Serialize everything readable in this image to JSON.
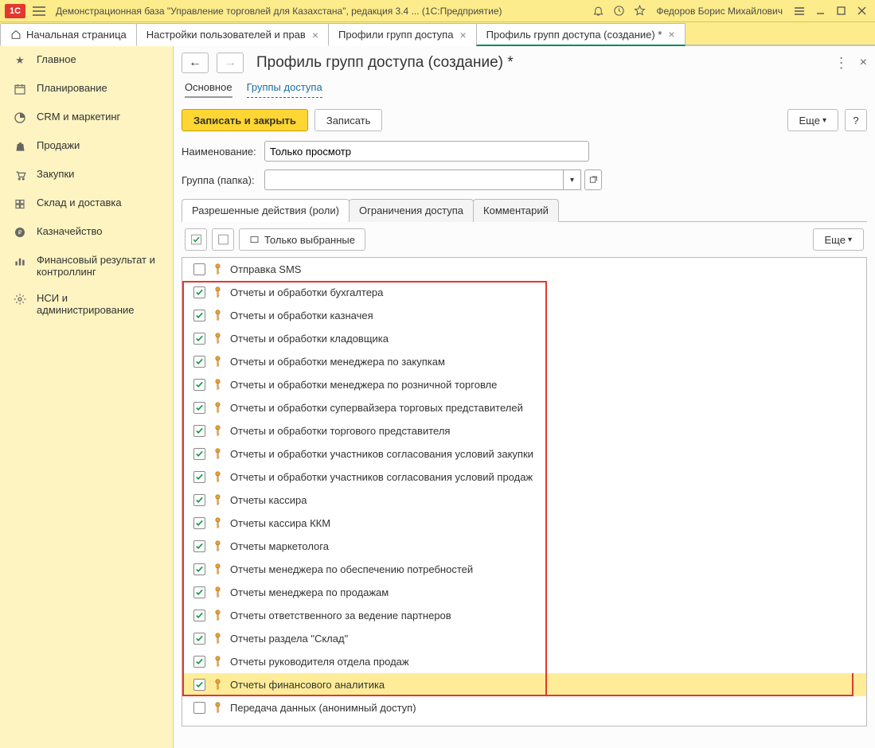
{
  "titlebar": {
    "app_title": "Демонстрационная база \"Управление торговлей для Казахстана\", редакция 3.4 ...  (1С:Предприятие)",
    "user": "Федоров Борис Михайлович"
  },
  "apptabs": {
    "home": "Начальная страница",
    "t1": "Настройки пользователей и прав",
    "t2": "Профили групп доступа",
    "t3": "Профиль групп доступа (создание) *"
  },
  "sidebar": {
    "items": [
      {
        "label": "Главное"
      },
      {
        "label": "Планирование"
      },
      {
        "label": "CRM и маркетинг"
      },
      {
        "label": "Продажи"
      },
      {
        "label": "Закупки"
      },
      {
        "label": "Склад и доставка"
      },
      {
        "label": "Казначейство"
      },
      {
        "label": "Финансовый результат и контроллинг"
      },
      {
        "label": "НСИ и администрирование"
      }
    ]
  },
  "form": {
    "title": "Профиль групп доступа (создание) *",
    "sub_main": "Основное",
    "sub_groups": "Группы доступа",
    "btn_write_close": "Записать и закрыть",
    "btn_write": "Записать",
    "btn_more": "Еще",
    "btn_q": "?",
    "lbl_name": "Наименование:",
    "val_name": "Только просмотр",
    "lbl_group": "Группа (папка):",
    "tab_roles": "Разрешенные действия (роли)",
    "tab_restrict": "Ограничения доступа",
    "tab_comment": "Комментарий",
    "btn_only_selected": "Только выбранные"
  },
  "roles": {
    "items": [
      {
        "checked": false,
        "label": "Отправка SMS"
      },
      {
        "checked": true,
        "label": "Отчеты и обработки бухгалтера"
      },
      {
        "checked": true,
        "label": "Отчеты и обработки казначея"
      },
      {
        "checked": true,
        "label": "Отчеты и обработки кладовщика"
      },
      {
        "checked": true,
        "label": "Отчеты и обработки менеджера по закупкам"
      },
      {
        "checked": true,
        "label": "Отчеты и обработки менеджера по розничной торговле"
      },
      {
        "checked": true,
        "label": "Отчеты и обработки супервайзера торговых представителей"
      },
      {
        "checked": true,
        "label": "Отчеты и обработки торгового представителя"
      },
      {
        "checked": true,
        "label": "Отчеты и обработки участников согласования условий закупки"
      },
      {
        "checked": true,
        "label": "Отчеты и обработки участников согласования условий продаж"
      },
      {
        "checked": true,
        "label": "Отчеты кассира"
      },
      {
        "checked": true,
        "label": "Отчеты кассира ККМ"
      },
      {
        "checked": true,
        "label": "Отчеты маркетолога"
      },
      {
        "checked": true,
        "label": "Отчеты менеджера по обеспечению потребностей"
      },
      {
        "checked": true,
        "label": "Отчеты менеджера по продажам"
      },
      {
        "checked": true,
        "label": "Отчеты ответственного за ведение партнеров"
      },
      {
        "checked": true,
        "label": "Отчеты раздела \"Склад\""
      },
      {
        "checked": true,
        "label": "Отчеты руководителя отдела продаж"
      },
      {
        "checked": true,
        "label": "Отчеты финансового аналитика",
        "selected": true
      },
      {
        "checked": false,
        "label": "Передача данных (анонимный доступ)"
      }
    ]
  }
}
